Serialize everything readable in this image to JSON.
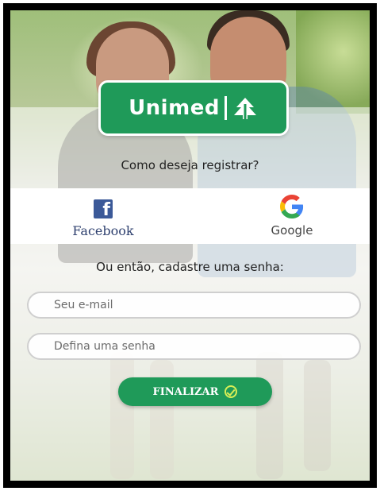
{
  "brand": {
    "name": "Unimed",
    "color": "#1f9a59"
  },
  "register": {
    "question": "Como deseja registrar?",
    "facebook_label": "Facebook",
    "facebook_icon": "facebook-icon",
    "google_label": "Google",
    "google_icon": "google-icon",
    "alt_text": "Ou então, cadastre uma senha:"
  },
  "form": {
    "email": {
      "value": "",
      "placeholder": "Seu e-mail"
    },
    "password": {
      "value": "",
      "placeholder": "Defina uma senha"
    },
    "submit_label": "FINALIZAR",
    "submit_icon": "check-circle-icon",
    "accent": "#d7ee56"
  }
}
